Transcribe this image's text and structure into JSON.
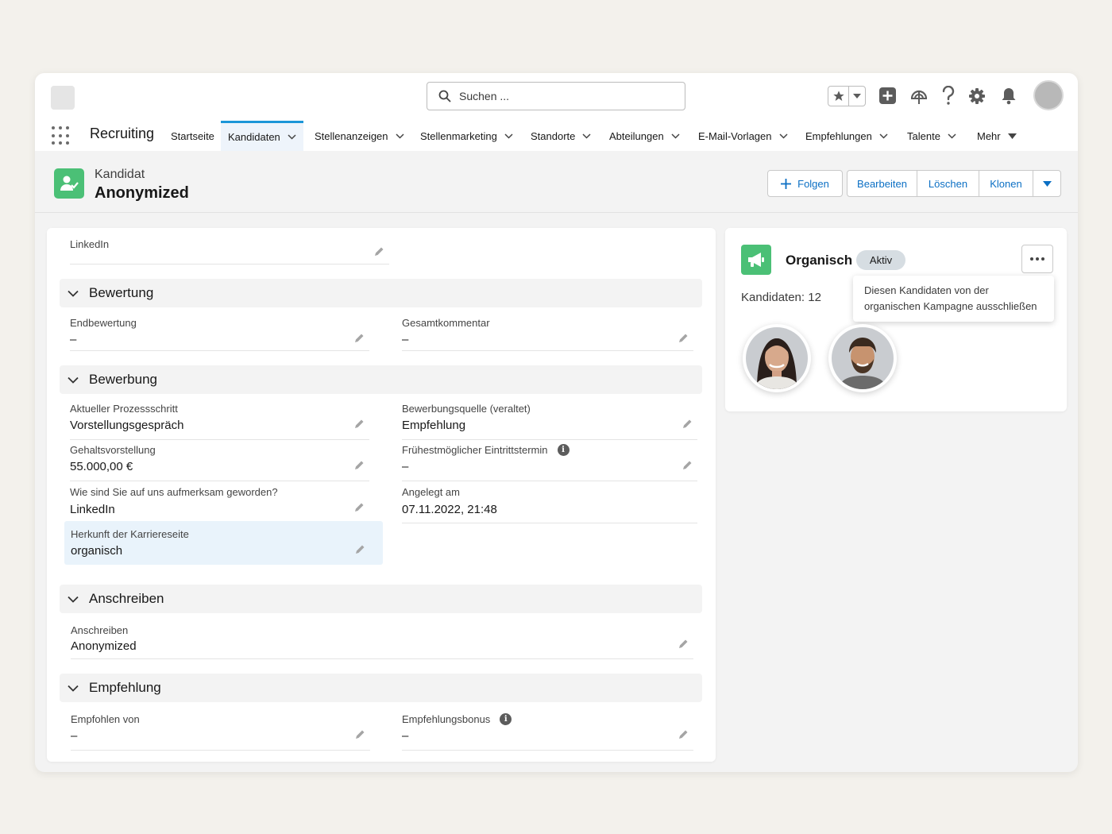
{
  "header": {
    "search_placeholder": "Suchen ...",
    "app_name": "Recruiting",
    "nav": [
      {
        "label": "Startseite"
      },
      {
        "label": "Kandidaten"
      },
      {
        "label": "Stellenanzeigen"
      },
      {
        "label": "Stellenmarketing"
      },
      {
        "label": "Standorte"
      },
      {
        "label": "Abteilungen"
      },
      {
        "label": "E-Mail-Vorlagen"
      },
      {
        "label": "Empfehlungen"
      },
      {
        "label": "Talente"
      },
      {
        "label": "Mehr"
      }
    ],
    "active_nav": "Kandidaten"
  },
  "record": {
    "type": "Kandidat",
    "title": "Anonymized",
    "actions": {
      "follow": "Folgen",
      "edit": "Bearbeiten",
      "delete": "Löschen",
      "clone": "Klonen"
    }
  },
  "details": {
    "linkedin": {
      "label": "LinkedIn",
      "value": ""
    },
    "sections": {
      "bewertung": "Bewertung",
      "bewerbung": "Bewerbung",
      "anschreiben": "Anschreiben",
      "empfehlung": "Empfehlung"
    },
    "endbewertung": {
      "label": "Endbewertung",
      "value": "–"
    },
    "gesamtkommentar": {
      "label": "Gesamtkommentar",
      "value": "–"
    },
    "prozessschritt": {
      "label": "Aktueller Prozessschritt",
      "value": "Vorstellungsgespräch"
    },
    "bewerbungsquelle": {
      "label": "Bewerbungsquelle (veraltet)",
      "value": "Empfehlung"
    },
    "gehalt": {
      "label": "Gehaltsvorstellung",
      "value": "55.000,00 €"
    },
    "eintritt": {
      "label": "Frühestmöglicher Eintrittstermin",
      "value": "–"
    },
    "aufmerksam": {
      "label": "Wie sind Sie auf uns aufmerksam geworden?",
      "value": "LinkedIn"
    },
    "angelegt": {
      "label": "Angelegt am",
      "value": "07.11.2022, 21:48"
    },
    "herkunft": {
      "label": "Herkunft der Karriereseite",
      "value": "organisch"
    },
    "anschreiben": {
      "label": "Anschreiben",
      "value": "Anonymized"
    },
    "empfohlen_von": {
      "label": "Empfohlen von",
      "value": "–"
    },
    "empfehlungsbonus": {
      "label": "Empfehlungsbonus",
      "value": "–"
    }
  },
  "campaign": {
    "name": "Organisch",
    "status": "Aktiv",
    "count_label": "Kandidaten: 12",
    "menu_tooltip_line1": "Diesen Kandidaten von der",
    "menu_tooltip_line2": "organischen Kampagne ausschließen"
  },
  "colors": {
    "accent_green": "#4bc076",
    "link_blue": "#0b6fc4",
    "active_tab_border": "#1b96d8",
    "highlight_field": "#e9f3fb"
  }
}
